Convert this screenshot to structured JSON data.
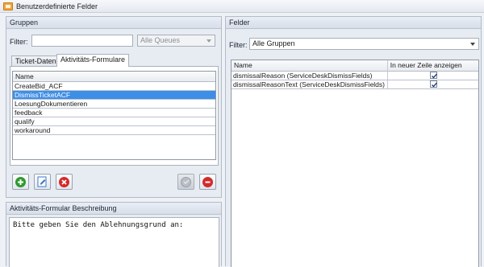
{
  "window": {
    "title": "Benutzerdefinierte Felder"
  },
  "groups": {
    "header": "Gruppen",
    "filter_label": "Filter:",
    "filter_value": "",
    "queue_select": "Alle Queues",
    "tabs": [
      {
        "label": "Ticket-Daten",
        "active": false
      },
      {
        "label": "Aktivitäts-Formulare",
        "active": true
      }
    ],
    "list_header": "Name",
    "items": [
      {
        "label": "CreateBid_ACF",
        "selected": false
      },
      {
        "label": "DismissTicketACF",
        "selected": true
      },
      {
        "label": "LoesungDokumentieren",
        "selected": false
      },
      {
        "label": "feedback",
        "selected": false
      },
      {
        "label": "qualify",
        "selected": false
      },
      {
        "label": "workaround",
        "selected": false
      }
    ],
    "buttons": {
      "add": "add-icon",
      "edit": "edit-icon",
      "delete": "delete-icon",
      "apply": "check-icon",
      "remove": "remove-icon"
    }
  },
  "description": {
    "header": "Aktivitäts-Formular Beschreibung",
    "text": "Bitte geben Sie den Ablehnungsgrund an:"
  },
  "fields": {
    "header": "Felder",
    "filter_label": "Filter:",
    "group_select": "Alle Gruppen",
    "columns": [
      "Name",
      "In neuer Zeile anzeigen"
    ],
    "rows": [
      {
        "name": "dismissalReason (ServiceDeskDismissFields)",
        "new_line": true
      },
      {
        "name": "dismissalReasonText (ServiceDeskDismissFields)",
        "new_line": true
      }
    ]
  },
  "colors": {
    "selection": "#3d8ee6",
    "add_green": "#2d9b2d",
    "delete_red": "#d42a2a"
  }
}
